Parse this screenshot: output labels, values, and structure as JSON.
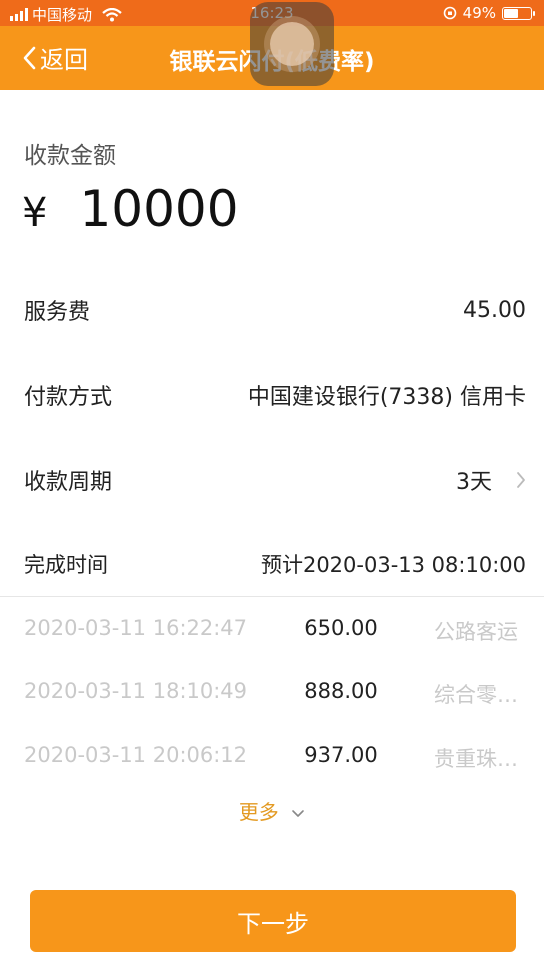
{
  "status_bar": {
    "carrier": "中国移动",
    "time": "16:23",
    "battery": "49%",
    "battery_level": 0.49
  },
  "nav": {
    "back_label": "返回",
    "title": "银联云闪付(低费率)"
  },
  "amount": {
    "label": "收款金额",
    "currency": "¥",
    "value": "10000"
  },
  "rows": {
    "service_fee": {
      "label": "服务费",
      "value": "45.00"
    },
    "payment_method": {
      "label": "付款方式",
      "value": "中国建设银行(7338)  信用卡"
    },
    "cycle": {
      "label": "收款周期",
      "value": "3天"
    },
    "completion": {
      "label": "完成时间",
      "value": "预计2020-03-13 08:10:00"
    }
  },
  "records": [
    {
      "time": "2020-03-11 16:22:47",
      "amount": "650.00",
      "merchant": "公路客运"
    },
    {
      "time": "2020-03-11 18:10:49",
      "amount": "888.00",
      "merchant": "综合零…"
    },
    {
      "time": "2020-03-11 20:06:12",
      "amount": "937.00",
      "merchant": "贵重珠…"
    }
  ],
  "more_label": "更多",
  "next_button": "下一步",
  "colors": {
    "status_bar": "#ef6b1a",
    "nav_bar": "#f7961a",
    "accent_text": "#e39a22",
    "button": "#f7961a"
  }
}
